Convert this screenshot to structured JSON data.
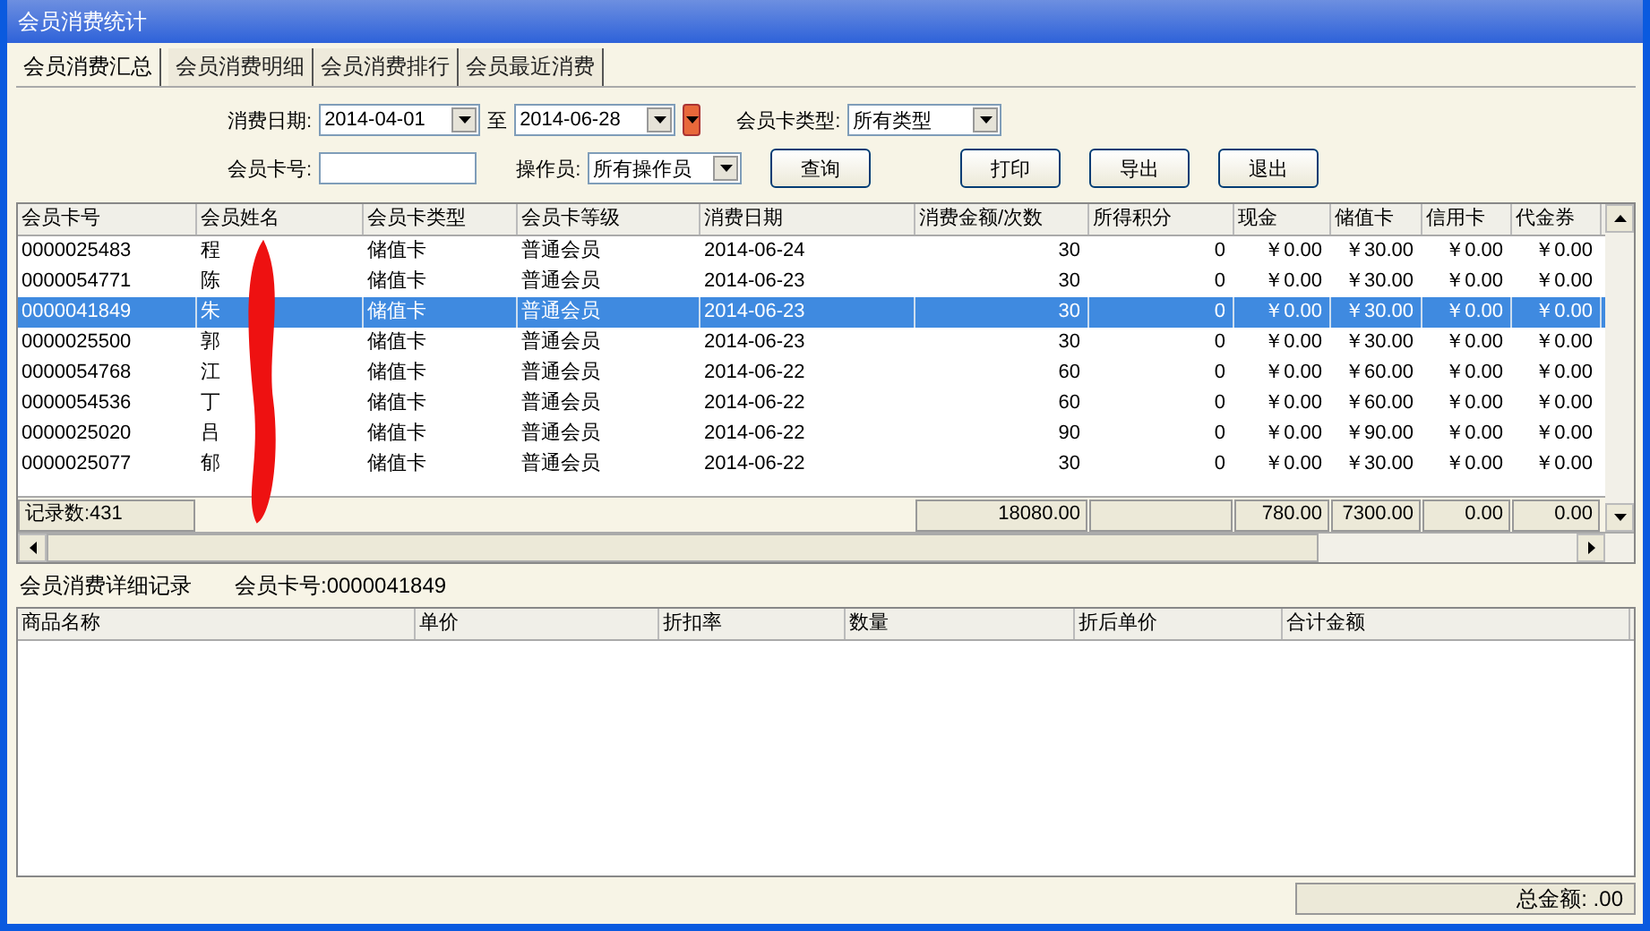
{
  "window": {
    "title": "会员消费统计"
  },
  "tabs": [
    {
      "label": "会员消费汇总",
      "selected": true
    },
    {
      "label": "会员消费明细",
      "selected": false
    },
    {
      "label": "会员消费排行",
      "selected": false
    },
    {
      "label": "会员最近消费",
      "selected": false
    }
  ],
  "filters": {
    "date_label": "消费日期:",
    "date_from": "2014-04-01",
    "date_to_label": "至",
    "date_to": "2014-06-28",
    "card_type_label": "会员卡类型:",
    "card_type": "所有类型",
    "card_no_label": "会员卡号:",
    "operator_label": "操作员:",
    "operator": "所有操作员"
  },
  "buttons": [
    {
      "label": "查询"
    },
    {
      "label": "打印"
    },
    {
      "label": "导出"
    },
    {
      "label": "退出"
    }
  ],
  "table": {
    "columns": [
      "会员卡号",
      "会员姓名",
      "会员卡类型",
      "会员卡等级",
      "消费日期",
      "消费金额/次数",
      "所得积分",
      "现金",
      "储值卡",
      "信用卡",
      "代金券"
    ],
    "rows": [
      {
        "cells": [
          "0000025483",
          "程",
          "储值卡",
          "普通会员",
          "2014-06-24",
          "30",
          "0",
          "￥0.00",
          "￥30.00",
          "￥0.00",
          "￥0.00"
        ],
        "selected": false
      },
      {
        "cells": [
          "0000054771",
          "陈",
          "储值卡",
          "普通会员",
          "2014-06-23",
          "30",
          "0",
          "￥0.00",
          "￥30.00",
          "￥0.00",
          "￥0.00"
        ],
        "selected": false
      },
      {
        "cells": [
          "0000041849",
          "朱",
          "储值卡",
          "普通会员",
          "2014-06-23",
          "30",
          "0",
          "￥0.00",
          "￥30.00",
          "￥0.00",
          "￥0.00"
        ],
        "selected": true
      },
      {
        "cells": [
          "0000025500",
          "郭",
          "储值卡",
          "普通会员",
          "2014-06-23",
          "30",
          "0",
          "￥0.00",
          "￥30.00",
          "￥0.00",
          "￥0.00"
        ],
        "selected": false
      },
      {
        "cells": [
          "0000054768",
          "江",
          "储值卡",
          "普通会员",
          "2014-06-22",
          "60",
          "0",
          "￥0.00",
          "￥60.00",
          "￥0.00",
          "￥0.00"
        ],
        "selected": false
      },
      {
        "cells": [
          "0000054536",
          "丁",
          "储值卡",
          "普通会员",
          "2014-06-22",
          "60",
          "0",
          "￥0.00",
          "￥60.00",
          "￥0.00",
          "￥0.00"
        ],
        "selected": false
      },
      {
        "cells": [
          "0000025020",
          "吕",
          "储值卡",
          "普通会员",
          "2014-06-22",
          "90",
          "0",
          "￥0.00",
          "￥90.00",
          "￥0.00",
          "￥0.00"
        ],
        "selected": false
      },
      {
        "cells": [
          "0000025077",
          "郁",
          "储值卡",
          "普通会员",
          "2014-06-22",
          "30",
          "0",
          "￥0.00",
          "￥30.00",
          "￥0.00",
          "￥0.00"
        ],
        "selected": false
      }
    ],
    "footer": {
      "record_count": "记录数:431",
      "amount": "18080.00",
      "cash": "780.00",
      "stored_value": "7300.00",
      "credit": "0.00",
      "voucher": "0.00"
    }
  },
  "detail": {
    "title": "会员消费详细记录",
    "card_label": "会员卡号:0000041849",
    "columns": [
      "商品名称",
      "单价",
      "折扣率",
      "数量",
      "折后单价",
      "合计金额"
    ]
  },
  "status_bar": {
    "total": "总金额: .00"
  }
}
